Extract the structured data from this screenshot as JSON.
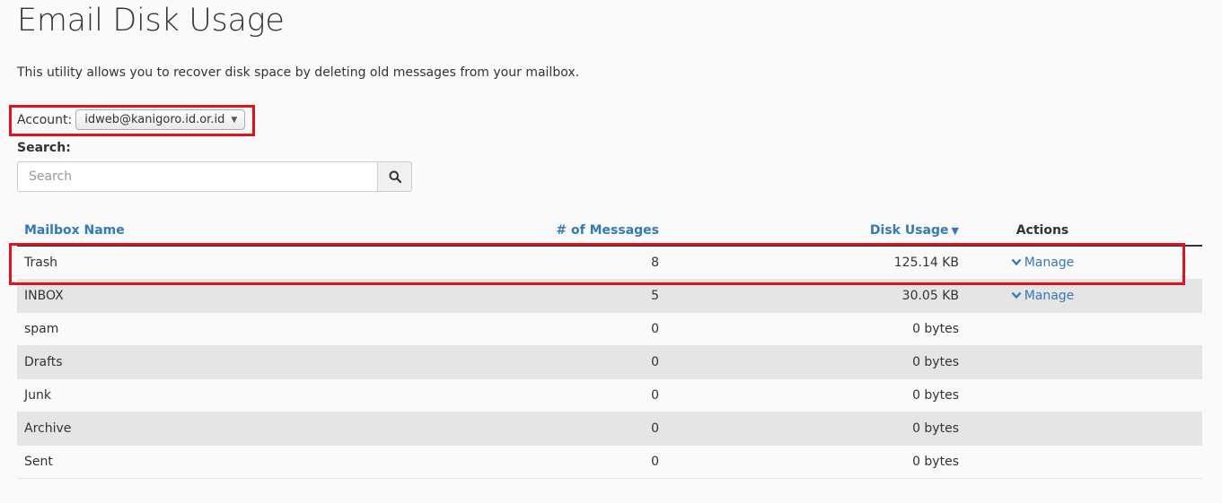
{
  "page": {
    "title": "Email Disk Usage",
    "intro": "This utility allows you to recover disk space by deleting old messages from your mailbox."
  },
  "account": {
    "label": "Account:",
    "selected": "idweb@kanigoro.id.or.id"
  },
  "search": {
    "label": "Search:",
    "placeholder": "Search",
    "value": ""
  },
  "table": {
    "headers": {
      "mailbox_name": "Mailbox Name",
      "messages": "# of Messages",
      "disk_usage": "Disk Usage",
      "actions": "Actions"
    },
    "rows": [
      {
        "name": "Trash",
        "messages": "8",
        "disk": "125.14 KB",
        "action": "Manage"
      },
      {
        "name": "INBOX",
        "messages": "5",
        "disk": "30.05 KB",
        "action": "Manage"
      },
      {
        "name": "spam",
        "messages": "0",
        "disk": "0 bytes",
        "action": ""
      },
      {
        "name": "Drafts",
        "messages": "0",
        "disk": "0 bytes",
        "action": ""
      },
      {
        "name": "Junk",
        "messages": "0",
        "disk": "0 bytes",
        "action": ""
      },
      {
        "name": "Archive",
        "messages": "0",
        "disk": "0 bytes",
        "action": ""
      },
      {
        "name": "Sent",
        "messages": "0",
        "disk": "0 bytes",
        "action": ""
      }
    ]
  },
  "colors": {
    "link": "#337ab7",
    "highlight": "#e0121b",
    "stripe": "#e5e5e5"
  }
}
